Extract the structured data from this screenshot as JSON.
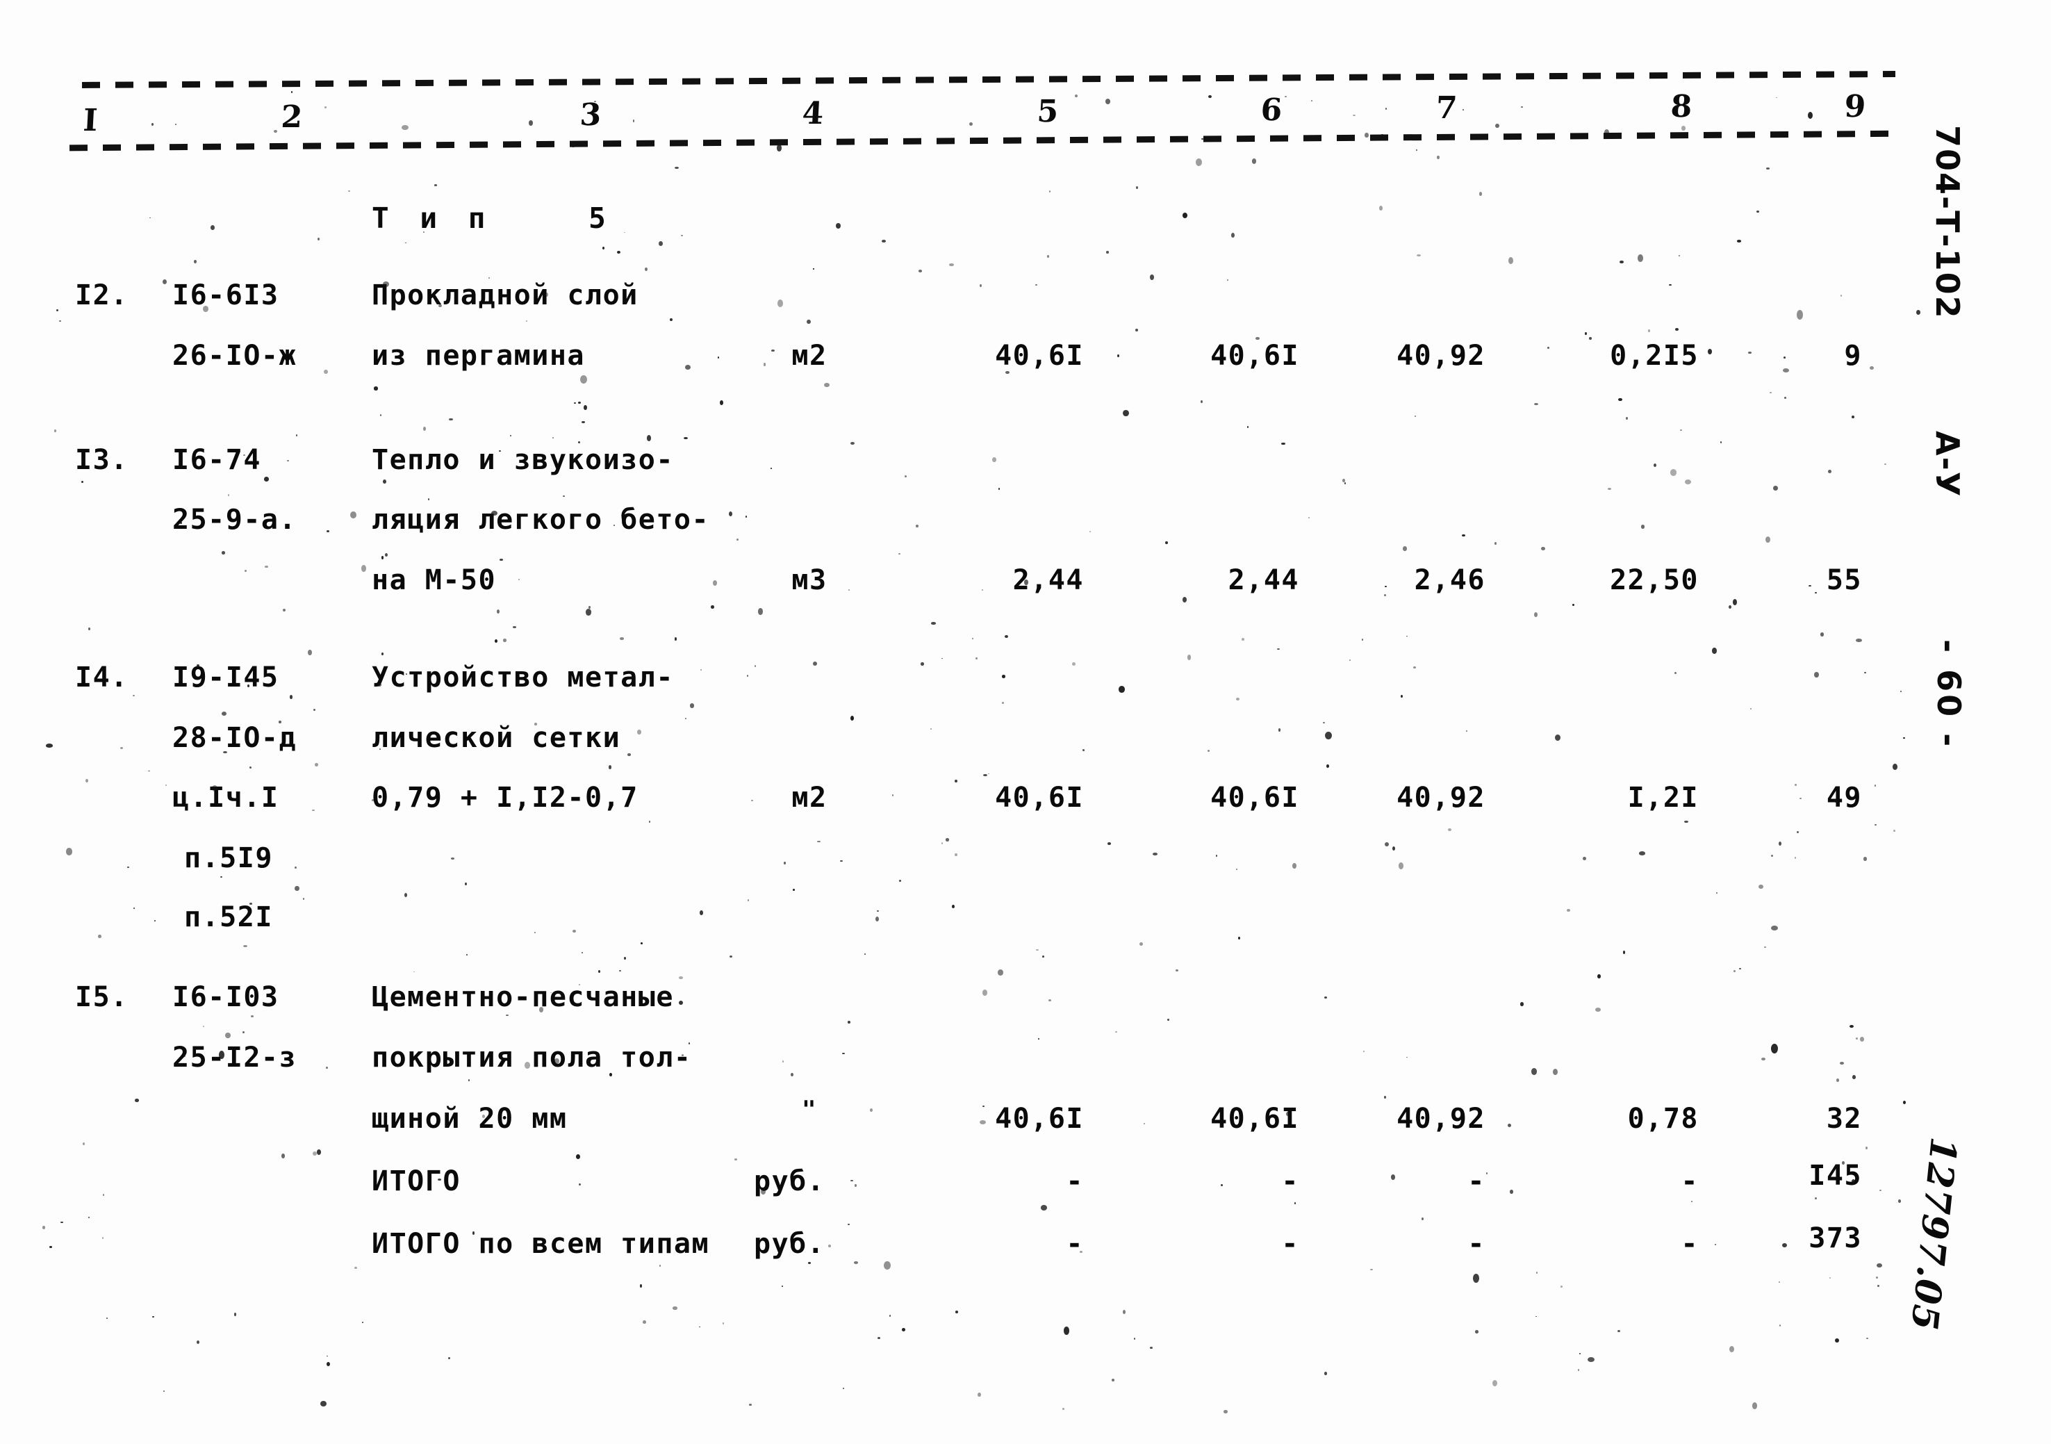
{
  "document": {
    "sheet_code": "704-Т-102",
    "revision_mark": "А-У",
    "page_number": "- 60 -",
    "handwritten_note": "12797.05"
  },
  "table": {
    "column_numbers": [
      "I",
      "2",
      "3",
      "4",
      "5",
      "6",
      "7",
      "8",
      "9"
    ],
    "section_title": "Т и п    5",
    "rows": [
      {
        "no": "I2.",
        "code_lines": [
          "I6-6I3",
          "26-IO-ж"
        ],
        "description_lines": [
          "Прокладной слой",
          "из пергамина"
        ],
        "unit": "м2",
        "c5": "40,6I",
        "c6": "40,6I",
        "c7": "40,92",
        "c8": "0,2I5",
        "c9": "9"
      },
      {
        "no": "I3.",
        "code_lines": [
          "I6-74",
          "25-9-а."
        ],
        "description_lines": [
          "Тепло и звукоизо-",
          "ляция легкого бето-",
          "на М-50"
        ],
        "unit": "м3",
        "c5": "2,44",
        "c6": "2,44",
        "c7": "2,46",
        "c8": "22,50",
        "c9": "55"
      },
      {
        "no": "I4.",
        "code_lines": [
          "I9-I45",
          "28-IO-д",
          "ц.Iч.I",
          "п.5I9",
          "п.52I"
        ],
        "description_lines": [
          "Устройство метал-",
          "лической сетки",
          "0,79 + I,I2-0,7"
        ],
        "unit": "м2",
        "c5": "40,6I",
        "c6": "40,6I",
        "c7": "40,92",
        "c8": "I,2I",
        "c9": "49"
      },
      {
        "no": "I5.",
        "code_lines": [
          "I6-I03",
          "25-I2-з"
        ],
        "description_lines": [
          "Цементно-песчаные",
          "покрытия пола тол-",
          "щиной 20 мм"
        ],
        "unit": "\"",
        "c5": "40,6I",
        "c6": "40,6I",
        "c7": "40,92",
        "c8": "0,78",
        "c9": "32"
      }
    ],
    "totals": [
      {
        "label": "ИТОГО",
        "unit": "руб.",
        "c5": "-",
        "c6": "-",
        "c7": "-",
        "c8": "-",
        "c9": "I45"
      },
      {
        "label": "ИТОГО по всем типам",
        "unit": "руб.",
        "c5": "-",
        "c6": "-",
        "c7": "-",
        "c8": "-",
        "c9": "373"
      }
    ]
  }
}
